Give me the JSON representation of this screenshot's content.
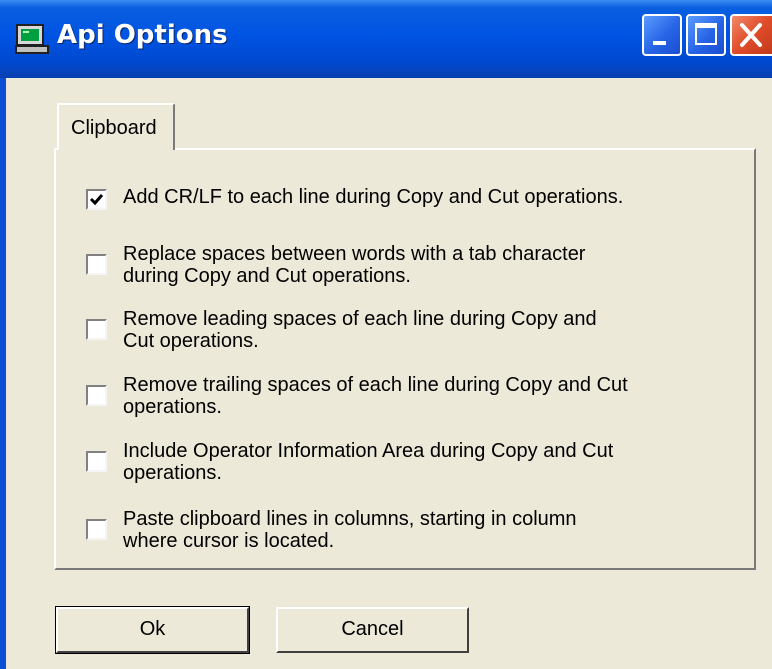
{
  "window": {
    "title": "Api Options",
    "icon": "terminal-icon",
    "controls": [
      "minimize-icon",
      "maximize-icon",
      "close-icon"
    ]
  },
  "tabs": [
    {
      "label": "Clipboard",
      "selected": true
    }
  ],
  "options": [
    {
      "label": "Add CR/LF to each line during Copy and Cut operations.",
      "checked": true
    },
    {
      "label": "Replace spaces between words with a tab character\nduring Copy and Cut operations.",
      "checked": false
    },
    {
      "label": "Remove leading spaces of each line during Copy and\nCut operations.",
      "checked": false
    },
    {
      "label": "Remove trailing spaces of each line during Copy and Cut\noperations.",
      "checked": false
    },
    {
      "label": "Include Operator Information Area during Copy and Cut\noperations.",
      "checked": false
    },
    {
      "label": "Paste clipboard lines in columns, starting in column\nwhere cursor is located.",
      "checked": false
    }
  ],
  "buttons": {
    "ok": "Ok",
    "cancel": "Cancel"
  },
  "colors": {
    "titlebar": "#0054e3",
    "dialog_bg": "#ece9d8",
    "close_button": "#e04c2a"
  }
}
